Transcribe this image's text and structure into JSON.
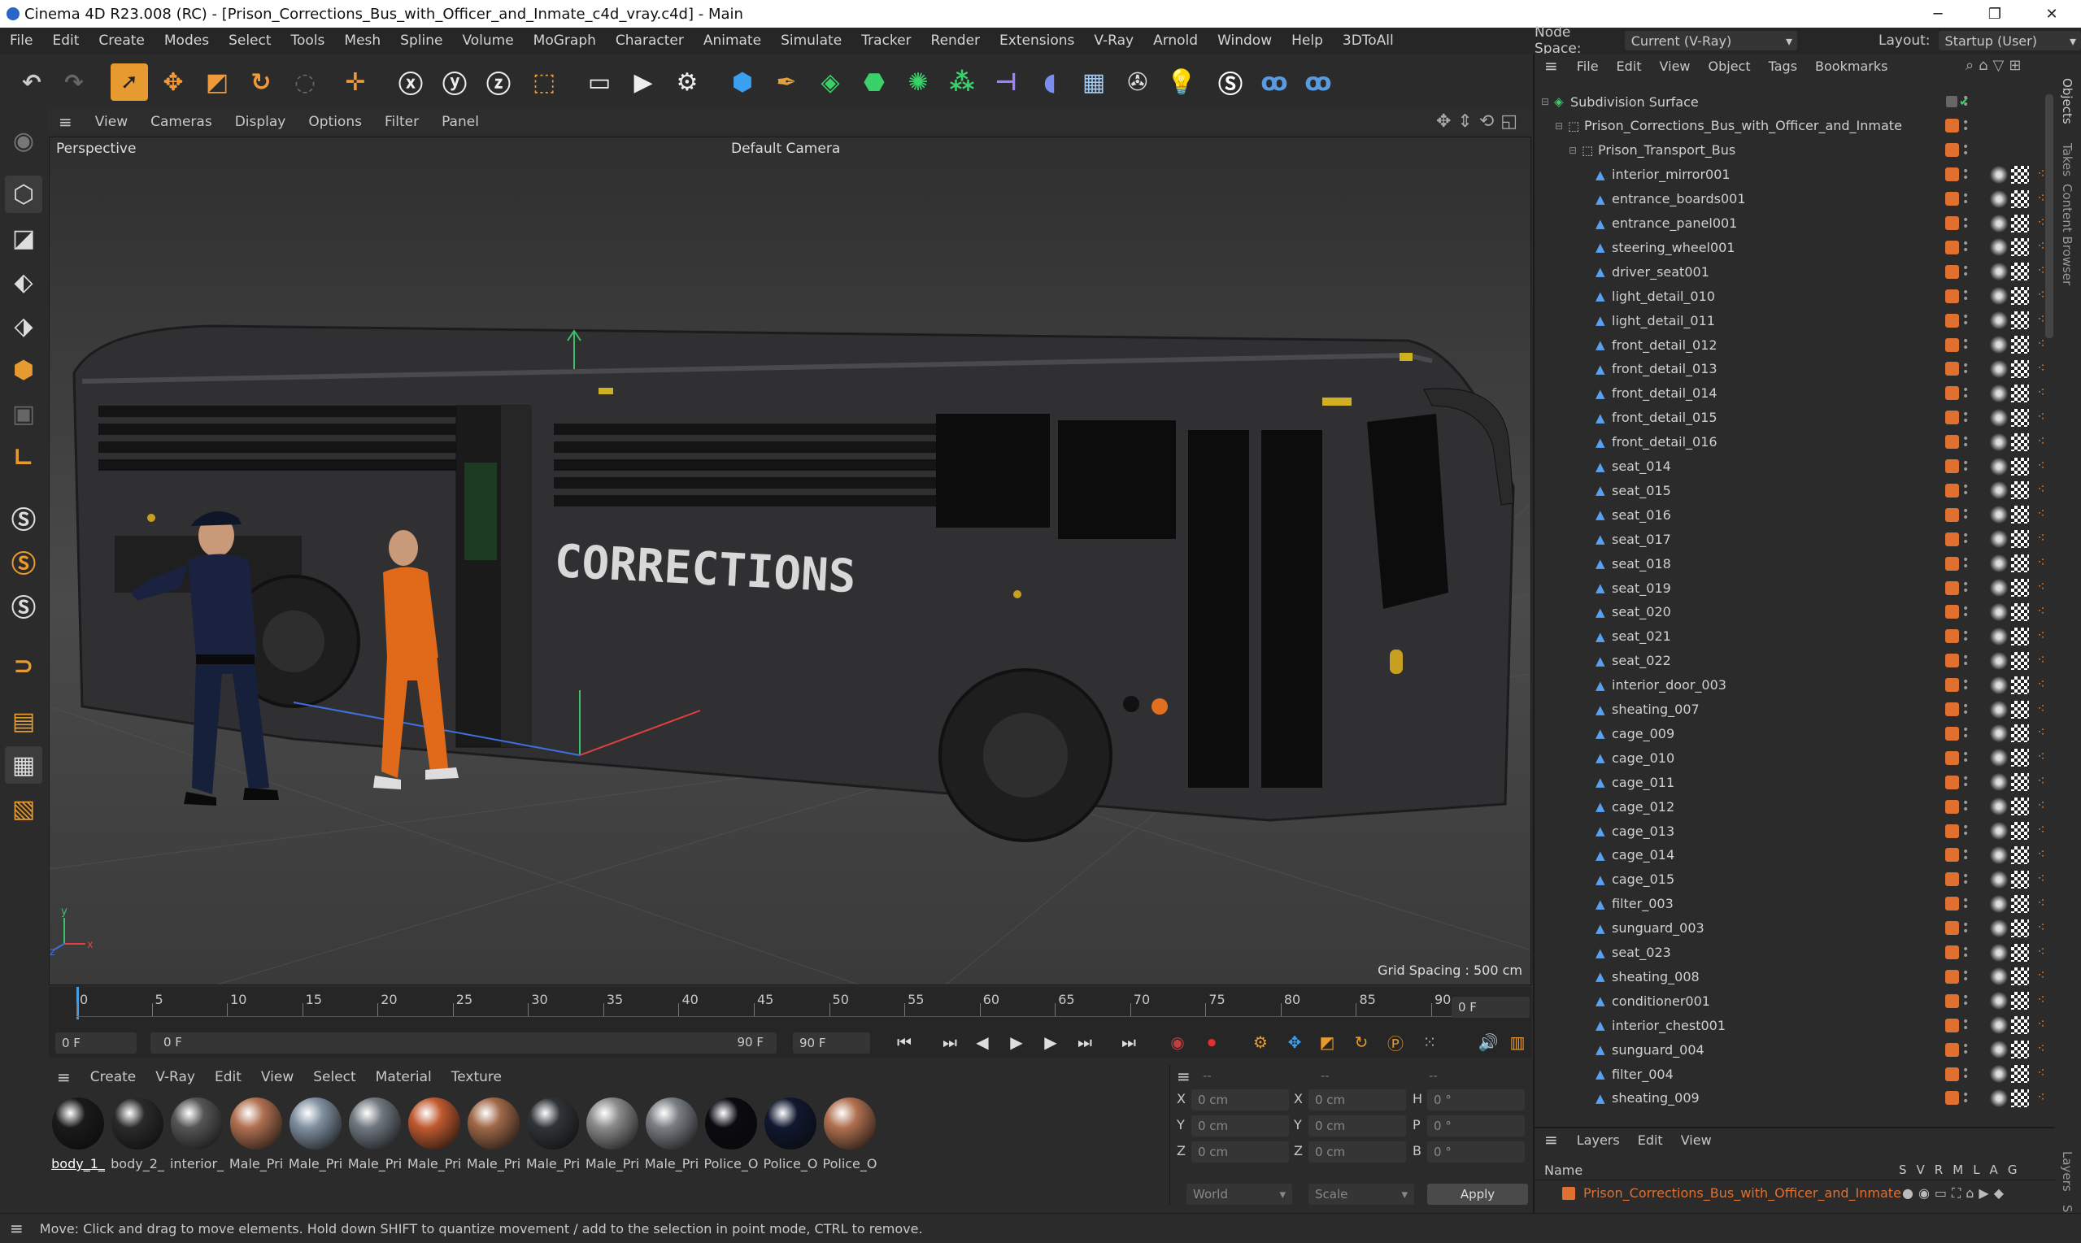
{
  "window": {
    "title": "Cinema 4D R23.008 (RC) - [Prison_Corrections_Bus_with_Officer_and_Inmate_c4d_vray.c4d] - Main",
    "minimize": "─",
    "maximize": "❐",
    "close": "✕"
  },
  "menu": [
    "File",
    "Edit",
    "Create",
    "Modes",
    "Select",
    "Tools",
    "Mesh",
    "Spline",
    "Volume",
    "MoGraph",
    "Character",
    "Animate",
    "Simulate",
    "Tracker",
    "Render",
    "Extensions",
    "V-Ray",
    "Arnold",
    "Window",
    "Help",
    "3DToAll"
  ],
  "nodespace": {
    "label": "Node Space:",
    "value": "Current (V-Ray)",
    "layout_label": "Layout:",
    "layout_value": "Startup (User)"
  },
  "viewport": {
    "menu": [
      "View",
      "Cameras",
      "Display",
      "Options",
      "Filter",
      "Panel"
    ],
    "name": "Perspective",
    "camera": "Default Camera",
    "grid_spacing": "Grid Spacing : 500 cm",
    "bus_text": "CORRECTIONS"
  },
  "timeline": {
    "ticks": [
      "0",
      "5",
      "10",
      "15",
      "20",
      "25",
      "30",
      "35",
      "40",
      "45",
      "50",
      "55",
      "60",
      "65",
      "70",
      "75",
      "80",
      "85",
      "90"
    ],
    "current_frame": "0 F",
    "start": "0 F",
    "range_start": "0 F",
    "range_end": "90 F",
    "end": "90 F"
  },
  "material_menu": [
    "Create",
    "V-Ray",
    "Edit",
    "View",
    "Select",
    "Material",
    "Texture"
  ],
  "materials": [
    {
      "label": "body_1_",
      "color": "#1a1a1a"
    },
    {
      "label": "body_2_",
      "color": "#2a2a2a"
    },
    {
      "label": "interior_",
      "color": "#555555"
    },
    {
      "label": "Male_Pri",
      "color": "#b07050"
    },
    {
      "label": "Male_Pri",
      "color": "#8090a0"
    },
    {
      "label": "Male_Pri",
      "color": "#707880"
    },
    {
      "label": "Male_Pri",
      "color": "#c05a30"
    },
    {
      "label": "Male_Pri",
      "color": "#a06848"
    },
    {
      "label": "Male_Pri",
      "color": "#303438"
    },
    {
      "label": "Male_Pri",
      "color": "#8a8a8a"
    },
    {
      "label": "Male_Pri",
      "color": "#7a7e84"
    },
    {
      "label": "Police_O",
      "color": "#0a0a10"
    },
    {
      "label": "Police_O",
      "color": "#101830"
    },
    {
      "label": "Police_O",
      "color": "#b07050"
    }
  ],
  "coords": {
    "x": "0 cm",
    "y": "0 cm",
    "z": "0 cm",
    "sx": "0 cm",
    "sy": "0 cm",
    "sz": "0 cm",
    "h": "0 °",
    "p": "0 °",
    "b": "0 °",
    "mode": "World",
    "scale": "Scale",
    "apply": "Apply",
    "header_dash": "--"
  },
  "status": "Move: Click and drag to move elements. Hold down SHIFT to quantize movement / add to the selection in point mode, CTRL to remove.",
  "objects_menu": [
    "File",
    "Edit",
    "View",
    "Object",
    "Tags",
    "Bookmarks"
  ],
  "objects": [
    {
      "name": "Subdivision Surface",
      "level": 0
    },
    {
      "name": "Prison_Corrections_Bus_with_Officer_and_Inmate",
      "level": 1
    },
    {
      "name": "Prison_Transport_Bus",
      "level": 2
    },
    {
      "name": "interior_mirror001",
      "level": 3
    },
    {
      "name": "entrance_boards001",
      "level": 3
    },
    {
      "name": "entrance_panel001",
      "level": 3
    },
    {
      "name": "steering_wheel001",
      "level": 3
    },
    {
      "name": "driver_seat001",
      "level": 3
    },
    {
      "name": "light_detail_010",
      "level": 3
    },
    {
      "name": "light_detail_011",
      "level": 3
    },
    {
      "name": "front_detail_012",
      "level": 3
    },
    {
      "name": "front_detail_013",
      "level": 3
    },
    {
      "name": "front_detail_014",
      "level": 3
    },
    {
      "name": "front_detail_015",
      "level": 3
    },
    {
      "name": "front_detail_016",
      "level": 3
    },
    {
      "name": "seat_014",
      "level": 3
    },
    {
      "name": "seat_015",
      "level": 3
    },
    {
      "name": "seat_016",
      "level": 3
    },
    {
      "name": "seat_017",
      "level": 3
    },
    {
      "name": "seat_018",
      "level": 3
    },
    {
      "name": "seat_019",
      "level": 3
    },
    {
      "name": "seat_020",
      "level": 3
    },
    {
      "name": "seat_021",
      "level": 3
    },
    {
      "name": "seat_022",
      "level": 3
    },
    {
      "name": "interior_door_003",
      "level": 3
    },
    {
      "name": "sheating_007",
      "level": 3
    },
    {
      "name": "cage_009",
      "level": 3
    },
    {
      "name": "cage_010",
      "level": 3
    },
    {
      "name": "cage_011",
      "level": 3
    },
    {
      "name": "cage_012",
      "level": 3
    },
    {
      "name": "cage_013",
      "level": 3
    },
    {
      "name": "cage_014",
      "level": 3
    },
    {
      "name": "cage_015",
      "level": 3
    },
    {
      "name": "filter_003",
      "level": 3
    },
    {
      "name": "sunguard_003",
      "level": 3
    },
    {
      "name": "seat_023",
      "level": 3
    },
    {
      "name": "sheating_008",
      "level": 3
    },
    {
      "name": "conditioner001",
      "level": 3
    },
    {
      "name": "interior_chest001",
      "level": 3
    },
    {
      "name": "sunguard_004",
      "level": 3
    },
    {
      "name": "filter_004",
      "level": 3
    },
    {
      "name": "sheating_009",
      "level": 3
    }
  ],
  "layers": {
    "menu": [
      "Layers",
      "Edit",
      "View"
    ],
    "name_header": "Name",
    "cols": [
      "S",
      "V",
      "R",
      "M",
      "L",
      "A",
      "G"
    ],
    "item": "Prison_Corrections_Bus_with_Officer_and_Inmate"
  },
  "side_tabs": [
    "Objects",
    "Takes",
    "Content Browser",
    "Layers",
    "Str"
  ]
}
